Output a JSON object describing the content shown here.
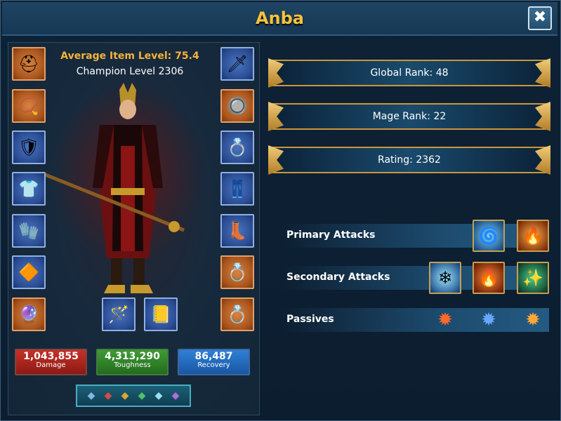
{
  "window": {
    "title": "Anba",
    "close_label": "✖"
  },
  "champion": {
    "average_item_level": "Average Item Level: 75.4",
    "champion_level": "Champion Level 2306"
  },
  "equipment": {
    "left": [
      {
        "icon": "helmet-icon",
        "glyph": "⛑"
      },
      {
        "icon": "amulet-icon",
        "glyph": "📿"
      },
      {
        "icon": "shoulders-icon",
        "glyph": "🛡"
      },
      {
        "icon": "chest-armor-icon",
        "glyph": "👕"
      },
      {
        "icon": "gloves-icon",
        "glyph": "🧤"
      },
      {
        "icon": "belt-icon",
        "glyph": "🔶"
      },
      {
        "icon": "gem-charm-icon",
        "glyph": "🔮"
      }
    ],
    "right": [
      {
        "icon": "weapon-icon",
        "glyph": "🗡"
      },
      {
        "icon": "bracer-icon",
        "glyph": "🔘"
      },
      {
        "icon": "ring-icon",
        "glyph": "💍"
      },
      {
        "icon": "pants-icon",
        "glyph": "👖"
      },
      {
        "icon": "boots-icon",
        "glyph": "👢"
      },
      {
        "icon": "gold-ring-icon",
        "glyph": "💍"
      },
      {
        "icon": "gold-ring-icon",
        "glyph": "💍"
      }
    ],
    "bottom": [
      {
        "icon": "staff-icon",
        "glyph": "🪄"
      },
      {
        "icon": "tome-icon",
        "glyph": "📒"
      }
    ]
  },
  "stats": {
    "damage": {
      "value": "1,043,855",
      "label": "Damage"
    },
    "toughness": {
      "value": "4,313,290",
      "label": "Toughness"
    },
    "recovery": {
      "value": "86,487",
      "label": "Recovery"
    }
  },
  "gems": [
    "◆",
    "◆",
    "◆",
    "◆",
    "◆",
    "◆"
  ],
  "gem_colors": [
    "#7fb8e8",
    "#d44a4a",
    "#e0a23a",
    "#53c067",
    "#9be0f0",
    "#b56adf"
  ],
  "ranks": {
    "global": "Global Rank: 48",
    "mage": "Mage Rank: 22",
    "rating": "Rating: 2362"
  },
  "skills": {
    "primary_label": "Primary Attacks",
    "secondary_label": "Secondary Attacks",
    "passives_label": "Passives"
  },
  "colors": {
    "title": "#f5c33c",
    "accent_gold": "#c9973f",
    "damage": "#c53128",
    "toughness": "#3f9b35",
    "recovery": "#2f80d6"
  }
}
